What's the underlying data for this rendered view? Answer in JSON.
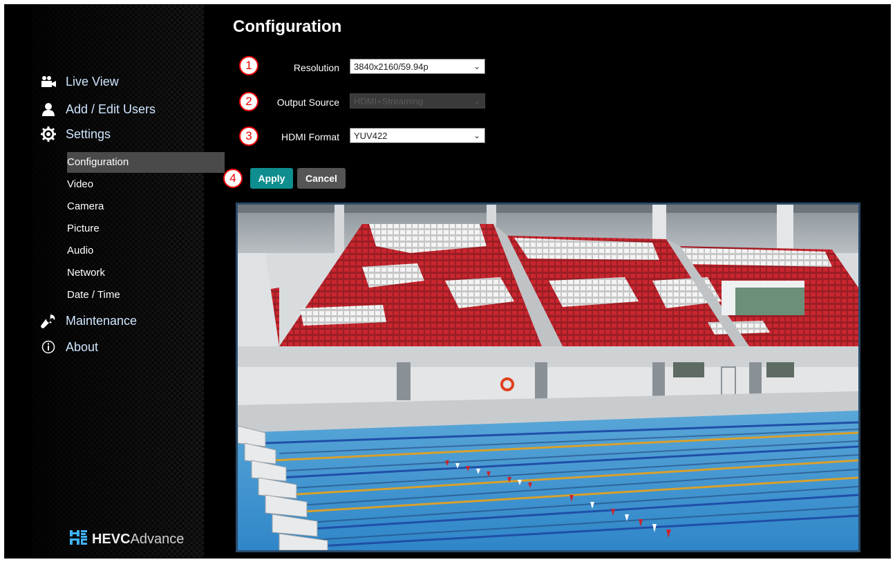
{
  "nav": {
    "items": [
      {
        "label": "Live View",
        "icon": "video-camera-icon"
      },
      {
        "label": "Add / Edit Users",
        "icon": "user-icon"
      },
      {
        "label": "Settings",
        "icon": "gear-icon"
      }
    ],
    "sub_items": [
      "Configuration",
      "Video",
      "Camera",
      "Picture",
      "Audio",
      "Network",
      "Date / Time"
    ],
    "more_items": [
      {
        "label": "Maintenance",
        "icon": "wrench-icon"
      },
      {
        "label": "About",
        "icon": "info-icon"
      }
    ],
    "active": "Configuration"
  },
  "page": {
    "title": "Configuration",
    "fields": [
      {
        "number": "1",
        "label": "Resolution",
        "value": "3840x2160/59.94p",
        "disabled": false
      },
      {
        "number": "2",
        "label": "Output Source",
        "value": "HDMI+Streaming",
        "disabled": true
      },
      {
        "number": "3",
        "label": "HDMI Format",
        "value": "YUV422",
        "disabled": false
      }
    ],
    "buttons_number": "4",
    "apply_label": "Apply",
    "cancel_label": "Cancel"
  },
  "logo": {
    "part1": "HEVC",
    "part2": "Advance"
  },
  "colors": {
    "accent": "#0e8e8e",
    "nav_text": "#cfe6ff",
    "badge": "#e00000"
  }
}
